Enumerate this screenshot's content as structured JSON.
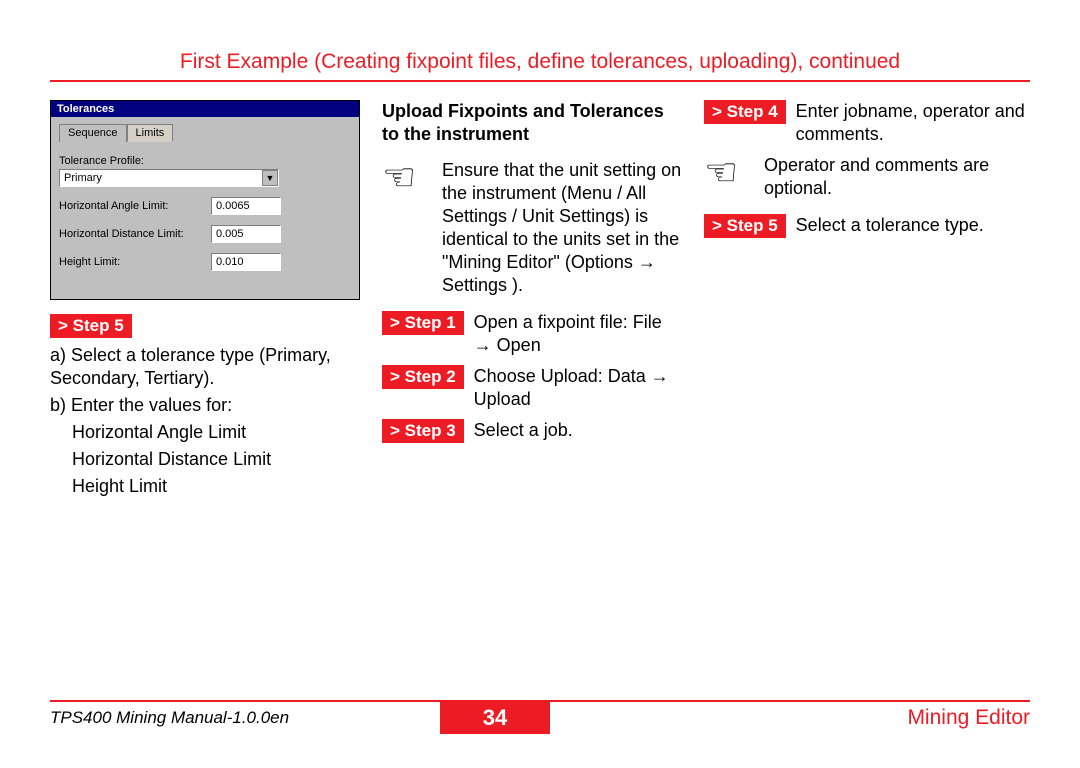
{
  "page_title": "First Example (Creating fixpoint files, define tolerances, uploading), continued",
  "dialog": {
    "title": "Tolerances",
    "tabs": [
      "Sequence",
      "Limits"
    ],
    "active_tab": "Limits",
    "profile_label": "Tolerance Profile:",
    "profile_value": "Primary",
    "hal_label": "Horizontal Angle Limit:",
    "hal_value": "0.0065",
    "hdl_label": "Horizontal Distance Limit:",
    "hdl_value": "0.005",
    "hl_label": "Height Limit:",
    "hl_value": "0.010"
  },
  "left": {
    "step5_badge": "> Step 5",
    "a": "a) Select a tolerance type (Primary, Secondary, Tertiary).",
    "b_intro": "b) Enter the values for:",
    "b_items": [
      "Horizontal Angle Limit",
      "Horizontal Distance Limit",
      "Height Limit"
    ]
  },
  "mid": {
    "heading": "Upload Fixpoints and Tolerances to the instrument",
    "note": "Ensure that the unit setting on the instrument (Menu / All Settings / Unit Settings) is identical to the units set in the \"Mining Editor\" (Options  → Settings ).",
    "steps": [
      {
        "badge": "> Step 1",
        "text": "Open a fixpoint file: File → Open"
      },
      {
        "badge": "> Step 2",
        "text": "Choose Upload: Data → Upload"
      },
      {
        "badge": "> Step 3",
        "text": "Select a job."
      }
    ]
  },
  "right": {
    "steps_top": [
      {
        "badge": "> Step 4",
        "text": "Enter jobname, operator and comments."
      }
    ],
    "note": "Operator and comments are optional.",
    "steps_bottom": [
      {
        "badge": "> Step 5",
        "text": "Select a tolerance type."
      }
    ]
  },
  "footer": {
    "left": "TPS400 Mining Manual-1.0.0en",
    "page": "34",
    "right": "Mining Editor"
  }
}
